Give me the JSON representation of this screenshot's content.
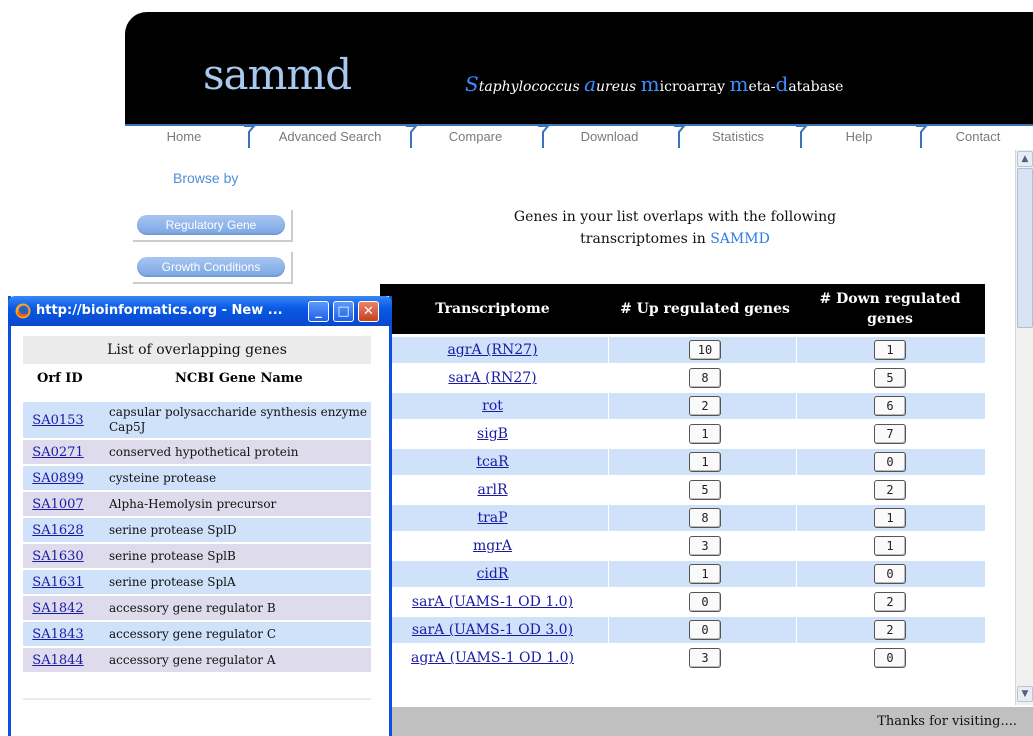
{
  "header": {
    "logo": "sammd",
    "tagline_parts": [
      {
        "cap": "S",
        "rest": "taphylococcus "
      },
      {
        "cap": "a",
        "rest": "ureus "
      },
      {
        "cap": "m",
        "rest": "icroarray "
      },
      {
        "cap": "m",
        "rest": "eta-"
      },
      {
        "cap": "d",
        "rest": "atabase"
      }
    ]
  },
  "nav": {
    "tabs": [
      "Home",
      "Advanced Search",
      "Compare",
      "Download",
      "Statistics",
      "Help",
      "Contact"
    ]
  },
  "sidebar": {
    "browse_by": "Browse by",
    "buttons": [
      "Regulatory Gene",
      "Growth Conditions"
    ]
  },
  "intro": {
    "line1": "Genes in your list overlaps with the following",
    "line2_prefix": "transcriptomes in ",
    "line2_brand": "SAMMD"
  },
  "table": {
    "headers": [
      "Transcriptome",
      "# Up regulated genes",
      "# Down regulated genes"
    ],
    "rows": [
      {
        "name": "agrA (RN27)",
        "up": "10",
        "down": "1"
      },
      {
        "name": "sarA (RN27)",
        "up": "8",
        "down": "5"
      },
      {
        "name": "rot",
        "up": "2",
        "down": "6"
      },
      {
        "name": "sigB",
        "up": "1",
        "down": "7"
      },
      {
        "name": "tcaR",
        "up": "1",
        "down": "0"
      },
      {
        "name": "arlR",
        "up": "5",
        "down": "2"
      },
      {
        "name": "traP",
        "up": "8",
        "down": "1"
      },
      {
        "name": "mgrA",
        "up": "3",
        "down": "1"
      },
      {
        "name": "cidR",
        "up": "1",
        "down": "0"
      },
      {
        "name": "sarA (UAMS-1 OD 1.0)",
        "up": "0",
        "down": "2"
      },
      {
        "name": "sarA (UAMS-1 OD 3.0)",
        "up": "0",
        "down": "2"
      },
      {
        "name": "agrA (UAMS-1 OD 1.0)",
        "up": "3",
        "down": "0"
      }
    ]
  },
  "footer": {
    "text": "Thanks for visiting...."
  },
  "popup": {
    "title": "http://bioinformatics.org - New ...",
    "heading": "List of overlapping genes",
    "col_id": "Orf ID",
    "col_name": "NCBI Gene Name",
    "rows": [
      {
        "id": "SA0153",
        "name": "capsular polysaccharide synthesis enzyme Cap5J"
      },
      {
        "id": "SA0271",
        "name": "conserved hypothetical protein"
      },
      {
        "id": "SA0899",
        "name": "cysteine protease"
      },
      {
        "id": "SA1007",
        "name": "Alpha-Hemolysin precursor"
      },
      {
        "id": "SA1628",
        "name": "serine protease SplD"
      },
      {
        "id": "SA1630",
        "name": "serine protease SplB"
      },
      {
        "id": "SA1631",
        "name": "serine protease SplA"
      },
      {
        "id": "SA1842",
        "name": "accessory gene regulator B"
      },
      {
        "id": "SA1843",
        "name": "accessory gene regulator C"
      },
      {
        "id": "SA1844",
        "name": "accessory gene regulator A"
      }
    ]
  },
  "colors": {
    "header_bg": "#000000",
    "logo": "#a8c8f0",
    "accent": "#3a8cff",
    "row_blue": "#cfe2fa",
    "link": "#1a1aa6",
    "popup_titlebar": "#0a5ae6"
  }
}
